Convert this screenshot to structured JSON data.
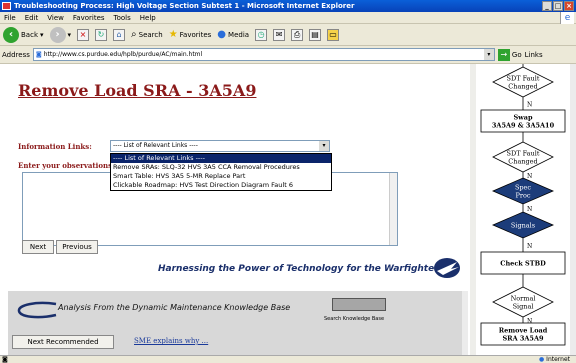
{
  "window": {
    "title": "Troubleshooting Process: High Voltage Section Subtest 1 - Microsoft Internet Explorer",
    "minimize": "_",
    "maximize": "□",
    "close": "×"
  },
  "menu": [
    "File",
    "Edit",
    "View",
    "Favorites",
    "Tools",
    "Help"
  ],
  "toolbar": {
    "back": "Back",
    "search": "Search",
    "favorites": "Favorites",
    "media": "Media"
  },
  "address": {
    "label": "Address",
    "url": "http://www.cs.purdue.edu/hplb/purdue/AC/main.html",
    "go": "Go",
    "links": "Links"
  },
  "main": {
    "heading": "Remove Load SRA - 3A5A9",
    "info_label": "Information Links:",
    "select_value": "---- List of Relevant Links ----",
    "options": [
      "---- List of Relevant Links ----",
      "Remove SRAs: SLQ-32 HVS 3A5 CCA Removal Procedures",
      "Smart Table: HVS 3A5 5-MR Replace Part",
      "Clickable Roadmap: HVS Test Direction Diagram Fault 6"
    ],
    "obs_label": "Enter your observations",
    "next_label": "Next",
    "previous_label": "Previous",
    "tagline": "Harnessing the Power of Technology for the Warfighter"
  },
  "lower": {
    "analysis_text": "Analysis From the  Dynamic Maintenance Knowledge Base",
    "kb_label": "Search Knowledge Base",
    "next_recommended": "Next Recommended",
    "sme_link": "SME explains why ..."
  },
  "flowchart": {
    "nodes": [
      {
        "type": "decision",
        "text": [
          "SDT Fault",
          "Changed"
        ]
      },
      {
        "type": "process",
        "text": [
          "Swap",
          "3A5A9 & 3A5A10"
        ]
      },
      {
        "type": "decision",
        "text": [
          "SDT Fault",
          "Changed"
        ]
      },
      {
        "type": "decision-dark",
        "text": [
          "Spec",
          "Proc"
        ]
      },
      {
        "type": "decision-dark",
        "text": [
          "Signals"
        ]
      },
      {
        "type": "process",
        "text": [
          "Check STBD"
        ]
      },
      {
        "type": "decision",
        "text": [
          "Normal",
          "Signal"
        ]
      },
      {
        "type": "process",
        "text": [
          "Remove Load",
          "SRA 3A5A9"
        ]
      }
    ],
    "edge_label": "N"
  },
  "status": {
    "zone": "Internet"
  }
}
